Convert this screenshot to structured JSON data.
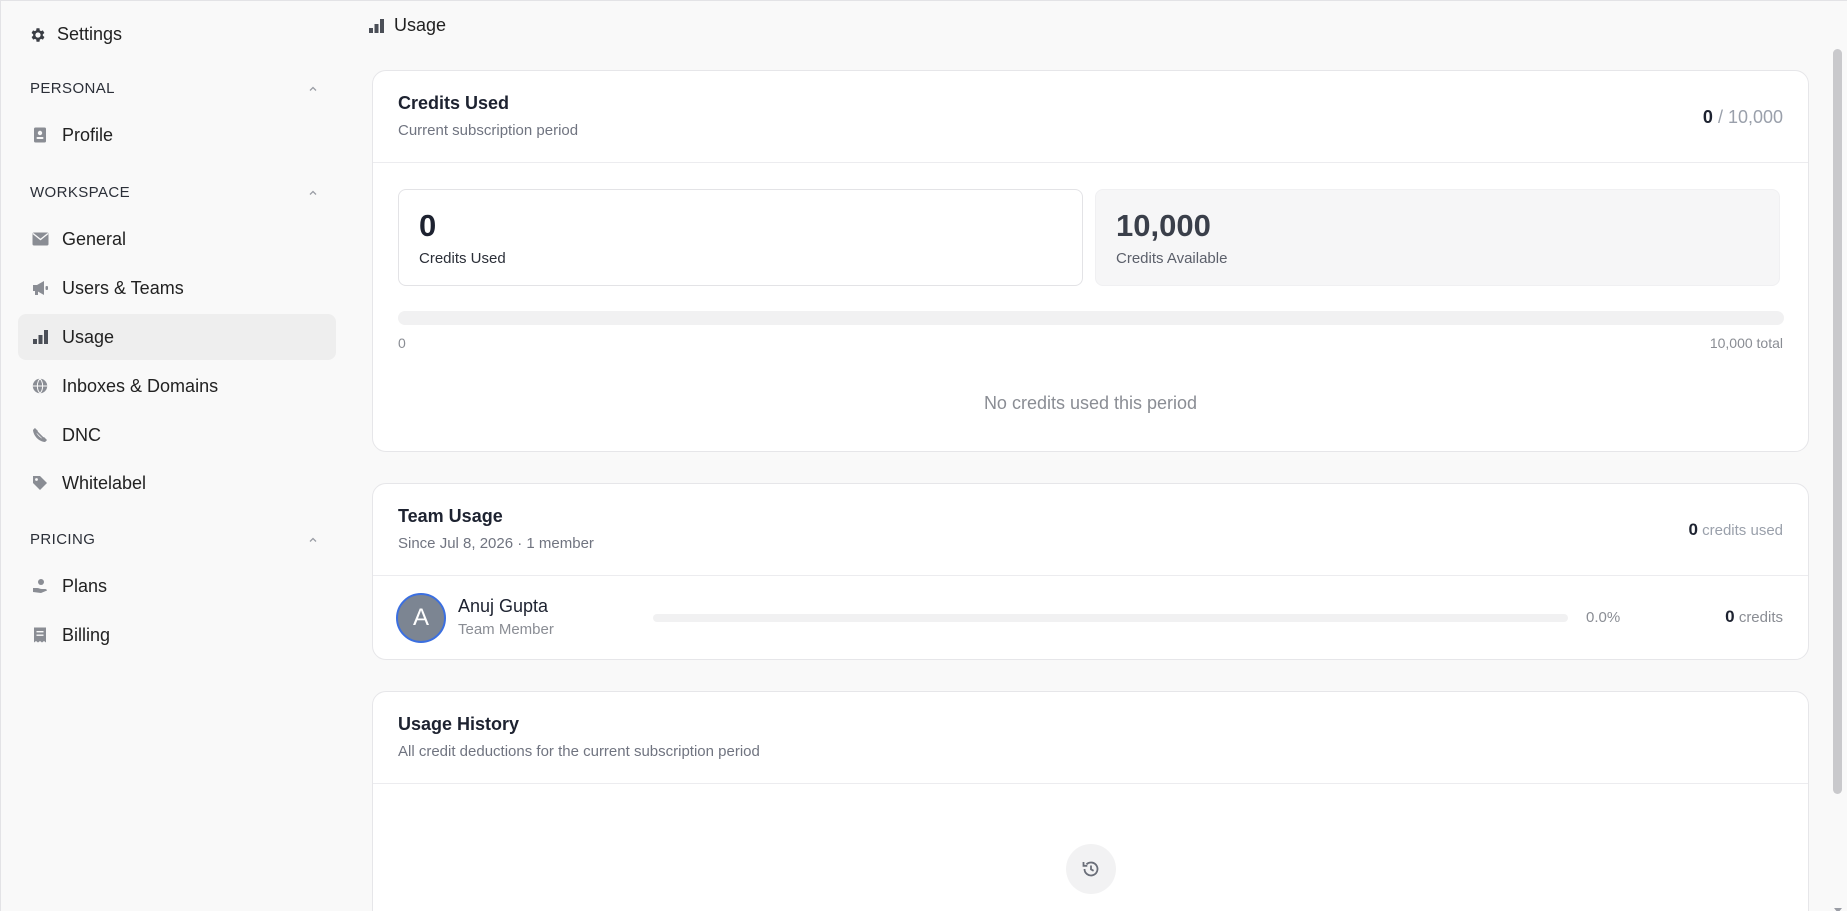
{
  "sidebar": {
    "title": "Settings",
    "sections": {
      "personal": "PERSONAL",
      "workspace": "WORKSPACE",
      "pricing": "PRICING"
    },
    "items": {
      "profile": "Profile",
      "general": "General",
      "users_teams": "Users & Teams",
      "usage": "Usage",
      "inboxes_domains": "Inboxes & Domains",
      "dnc": "DNC",
      "whitelabel": "Whitelabel",
      "plans": "Plans",
      "billing": "Billing"
    },
    "active_item": "Usage"
  },
  "page": {
    "title": "Usage"
  },
  "credits_card": {
    "title": "Credits Used",
    "subtitle": "Current subscription period",
    "used_value": "0",
    "total_value": "/ 10,000",
    "used_box": {
      "value": "0",
      "label": "Credits Used"
    },
    "available_box": {
      "value": "10,000",
      "label": "Credits Available"
    },
    "progress_fraction": 0,
    "bar_min_label": "0",
    "bar_max_label": "10,000 total",
    "empty_message": "No credits used this period"
  },
  "team_card": {
    "title": "Team Usage",
    "subtitle": "Since Jul 8, 2026 · 1 member",
    "total_used": "0",
    "total_used_suffix": "credits used",
    "members": [
      {
        "initial": "A",
        "name": "Anuj Gupta",
        "role": "Team Member",
        "percent": "0.0%",
        "usage_fraction": 0,
        "credits": "0",
        "credits_suffix": "credits"
      }
    ]
  },
  "history_card": {
    "title": "Usage History",
    "subtitle": "All credit deductions for the current subscription period",
    "icon": "history-icon"
  },
  "colors": {
    "accent": "#3b82f6",
    "avatar_ring": "#3b6fe0",
    "active_item_bg": "#eeeeee"
  }
}
